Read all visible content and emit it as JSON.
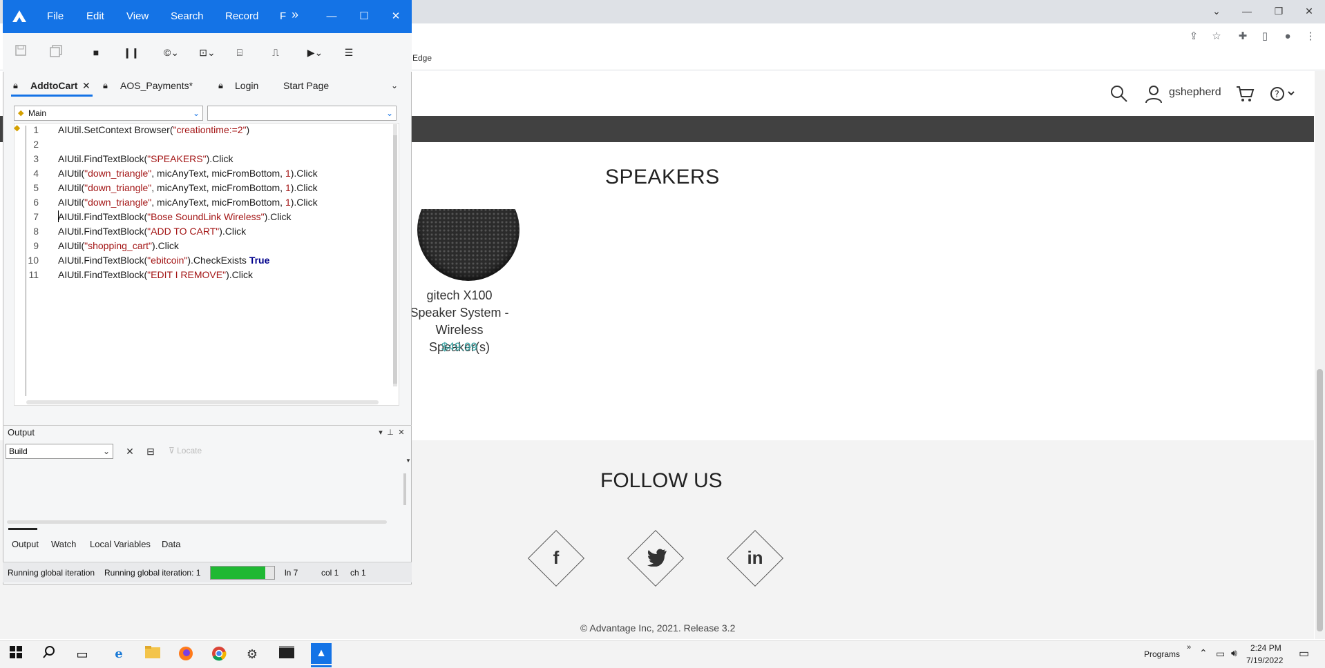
{
  "browser": {
    "bookmark_text": "Edge",
    "window_controls": [
      "⌄",
      "—",
      "❐",
      "✕"
    ],
    "address_icons": [
      "share-icon",
      "star-icon",
      "extensions-icon",
      "sidebar-icon",
      "profile-icon",
      "menu-icon"
    ]
  },
  "site": {
    "username": "gshepherd",
    "section_title": "SPEAKERS",
    "product": {
      "name": "gitech X100 Speaker System - Wireless Speaker(s)",
      "price": "$49.99"
    },
    "follow_title": "FOLLOW US",
    "social": [
      "f",
      "in"
    ],
    "copyright": "© Advantage Inc, 2021. Release 3.2"
  },
  "app": {
    "menu": [
      "File",
      "Edit",
      "View",
      "Search",
      "Record",
      "F"
    ],
    "more_menu_glyph": "»",
    "tabs": [
      {
        "label": "AddtoCart",
        "locked": true,
        "closable": true,
        "active": true
      },
      {
        "label": "AOS_Payments*",
        "locked": true,
        "active": false
      },
      {
        "label": "Login",
        "locked": true,
        "active": false
      },
      {
        "label": "Start Page",
        "locked": false,
        "active": false
      }
    ],
    "scope_combo": "Main",
    "function_combo": "",
    "code_lines": [
      {
        "n": "1",
        "parts": [
          [
            "t",
            "AIUtil.SetContext Browser("
          ],
          [
            "s",
            "\"creationtime:=2\""
          ],
          [
            "t",
            ")"
          ]
        ]
      },
      {
        "n": "2",
        "parts": []
      },
      {
        "n": "3",
        "parts": [
          [
            "t",
            "AIUtil.FindTextBlock("
          ],
          [
            "s",
            "\"SPEAKERS\""
          ],
          [
            "t",
            ").Click"
          ]
        ]
      },
      {
        "n": "4",
        "parts": [
          [
            "t",
            "AIUtil("
          ],
          [
            "s",
            "\"down_triangle\""
          ],
          [
            "t",
            ", micAnyText, micFromBottom, "
          ],
          [
            "s",
            "1"
          ],
          [
            "t",
            ").Click"
          ]
        ]
      },
      {
        "n": "5",
        "parts": [
          [
            "t",
            "AIUtil("
          ],
          [
            "s",
            "\"down_triangle\""
          ],
          [
            "t",
            ", micAnyText, micFromBottom, "
          ],
          [
            "s",
            "1"
          ],
          [
            "t",
            ").Click"
          ]
        ]
      },
      {
        "n": "6",
        "parts": [
          [
            "t",
            "AIUtil("
          ],
          [
            "s",
            "\"down_triangle\""
          ],
          [
            "t",
            ", micAnyText, micFromBottom, "
          ],
          [
            "s",
            "1"
          ],
          [
            "t",
            ").Click"
          ]
        ]
      },
      {
        "n": "7",
        "parts": [
          [
            "t",
            "AIUtil.FindTextBlock("
          ],
          [
            "s",
            "\"Bose SoundLink Wireless\""
          ],
          [
            "t",
            ").Click"
          ]
        ]
      },
      {
        "n": "8",
        "parts": [
          [
            "t",
            "AIUtil.FindTextBlock("
          ],
          [
            "s",
            "\"ADD TO CART\""
          ],
          [
            "t",
            ").Click"
          ]
        ]
      },
      {
        "n": "9",
        "parts": [
          [
            "t",
            "AIUtil("
          ],
          [
            "s",
            "\"shopping_cart\""
          ],
          [
            "t",
            ").Click"
          ]
        ]
      },
      {
        "n": "10",
        "parts": [
          [
            "t",
            "AIUtil.FindTextBlock("
          ],
          [
            "s",
            "\"ebitcoin\""
          ],
          [
            "t",
            ").CheckExists "
          ],
          [
            "k",
            "True"
          ]
        ]
      },
      {
        "n": "11",
        "parts": [
          [
            "t",
            "AIUtil.FindTextBlock("
          ],
          [
            "s",
            "\"EDIT I REMOVE\""
          ],
          [
            "t",
            ").Click"
          ]
        ]
      }
    ],
    "output": {
      "title": "Output",
      "build_combo": "Build",
      "locate_label": "Locate"
    },
    "bottom_tabs": [
      "Output",
      "Watch",
      "Local Variables",
      "Data"
    ],
    "status": {
      "left": "Running global iteration",
      "iteration": "Running global iteration: 1",
      "progress_fraction": 0.86,
      "ln": "ln 7",
      "col": "col 1",
      "ch": "ch 1"
    }
  },
  "taskbar": {
    "programs_label": "Programs",
    "chevron": "»",
    "time": "2:24 PM",
    "date": "7/19/2022"
  },
  "colors": {
    "app_accent": "#1473e6",
    "price": "#3aa3a3",
    "progress": "#1fb833",
    "string": "#a31515",
    "keyword": "#00008b"
  }
}
